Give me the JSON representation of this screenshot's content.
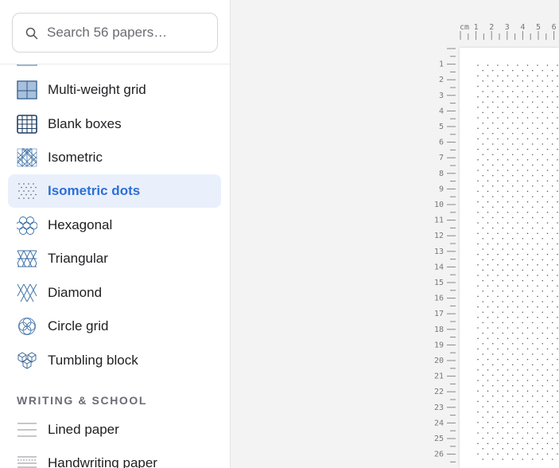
{
  "search": {
    "placeholder": "Search 56 papers…",
    "value": ""
  },
  "sidebar": {
    "items": [
      {
        "label": "Multi-weight grid",
        "icon": "multi-weight-grid-icon"
      },
      {
        "label": "Blank boxes",
        "icon": "blank-boxes-icon"
      },
      {
        "label": "Isometric",
        "icon": "isometric-icon"
      },
      {
        "label": "Isometric dots",
        "icon": "isometric-dots-icon",
        "selected": true
      },
      {
        "label": "Hexagonal",
        "icon": "hexagonal-icon"
      },
      {
        "label": "Triangular",
        "icon": "triangular-icon"
      },
      {
        "label": "Diamond",
        "icon": "diamond-icon"
      },
      {
        "label": "Circle grid",
        "icon": "circle-grid-icon"
      },
      {
        "label": "Tumbling block",
        "icon": "tumbling-block-icon"
      }
    ],
    "section_writing": {
      "title": "WRITING & SCHOOL",
      "items": [
        {
          "label": "Lined paper",
          "icon": "lined-paper-icon"
        },
        {
          "label": "Handwriting paper",
          "icon": "handwriting-paper-icon"
        }
      ]
    }
  },
  "preview": {
    "ruler_unit": "cm",
    "top_ruler_labels": [
      "1",
      "2",
      "3",
      "4",
      "5",
      "6"
    ],
    "left_ruler_labels": [
      "1",
      "2",
      "3",
      "4",
      "5",
      "6",
      "7",
      "8",
      "9",
      "10",
      "11",
      "12",
      "13",
      "14",
      "15",
      "16",
      "17",
      "18",
      "19",
      "20",
      "21",
      "22",
      "23",
      "24",
      "25",
      "26"
    ]
  },
  "colors": {
    "accent": "#2c6fd6",
    "selected_bg": "#e9f0fc",
    "thumb_stroke": "#3a6ea5",
    "dot": "#555555"
  }
}
